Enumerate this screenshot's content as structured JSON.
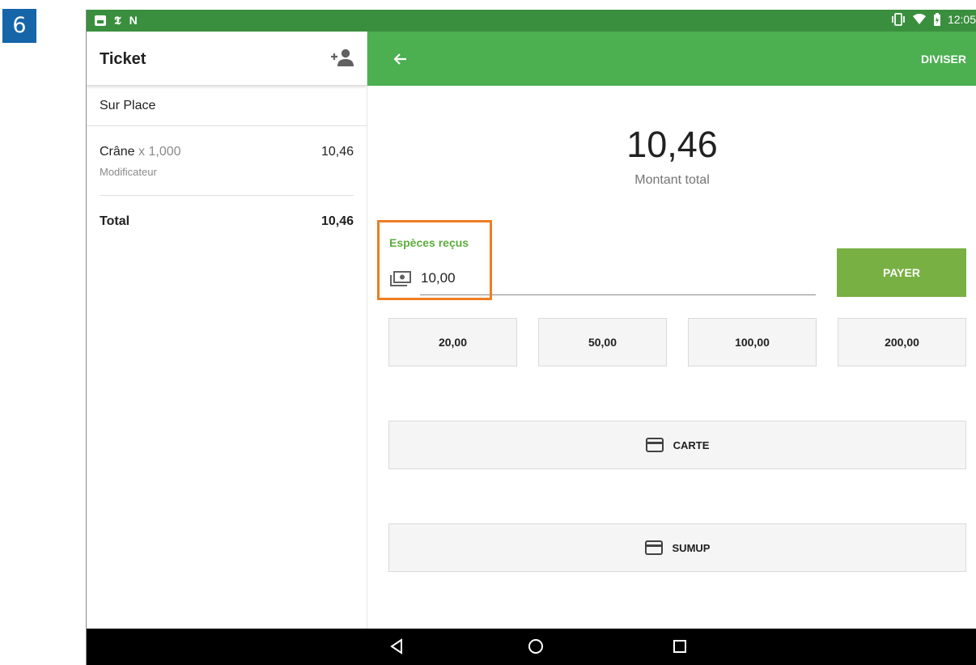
{
  "step_number": "6",
  "status_bar": {
    "time": "12:05",
    "notification_icons": [
      "image-icon",
      "news-icon",
      "n-icon"
    ],
    "system_icons": [
      "vibrate-icon",
      "wifi-icon",
      "battery-icon"
    ]
  },
  "ticket": {
    "title": "Ticket",
    "dining_option": "Sur Place",
    "items": [
      {
        "name": "Crâne",
        "quantity": "x 1,000",
        "modifier": "Modificateur",
        "price": "10,46"
      }
    ],
    "total_label": "Total",
    "total_value": "10,46"
  },
  "payment": {
    "split_label": "DIVISER",
    "total_amount": "10,46",
    "total_label": "Montant total",
    "cash_label": "Espèces reçus",
    "cash_value": "10,00",
    "pay_label": "PAYER",
    "quick_amounts": [
      "20,00",
      "50,00",
      "100,00",
      "200,00"
    ],
    "methods": [
      "CARTE",
      "SUMUP"
    ]
  },
  "colors": {
    "status_bar": "#3a8f3e",
    "app_bar": "#4caf50",
    "pay_button": "#78b043",
    "cash_label": "#5cad3c",
    "highlight": "#ef7d22",
    "step_badge": "#1565a8"
  }
}
